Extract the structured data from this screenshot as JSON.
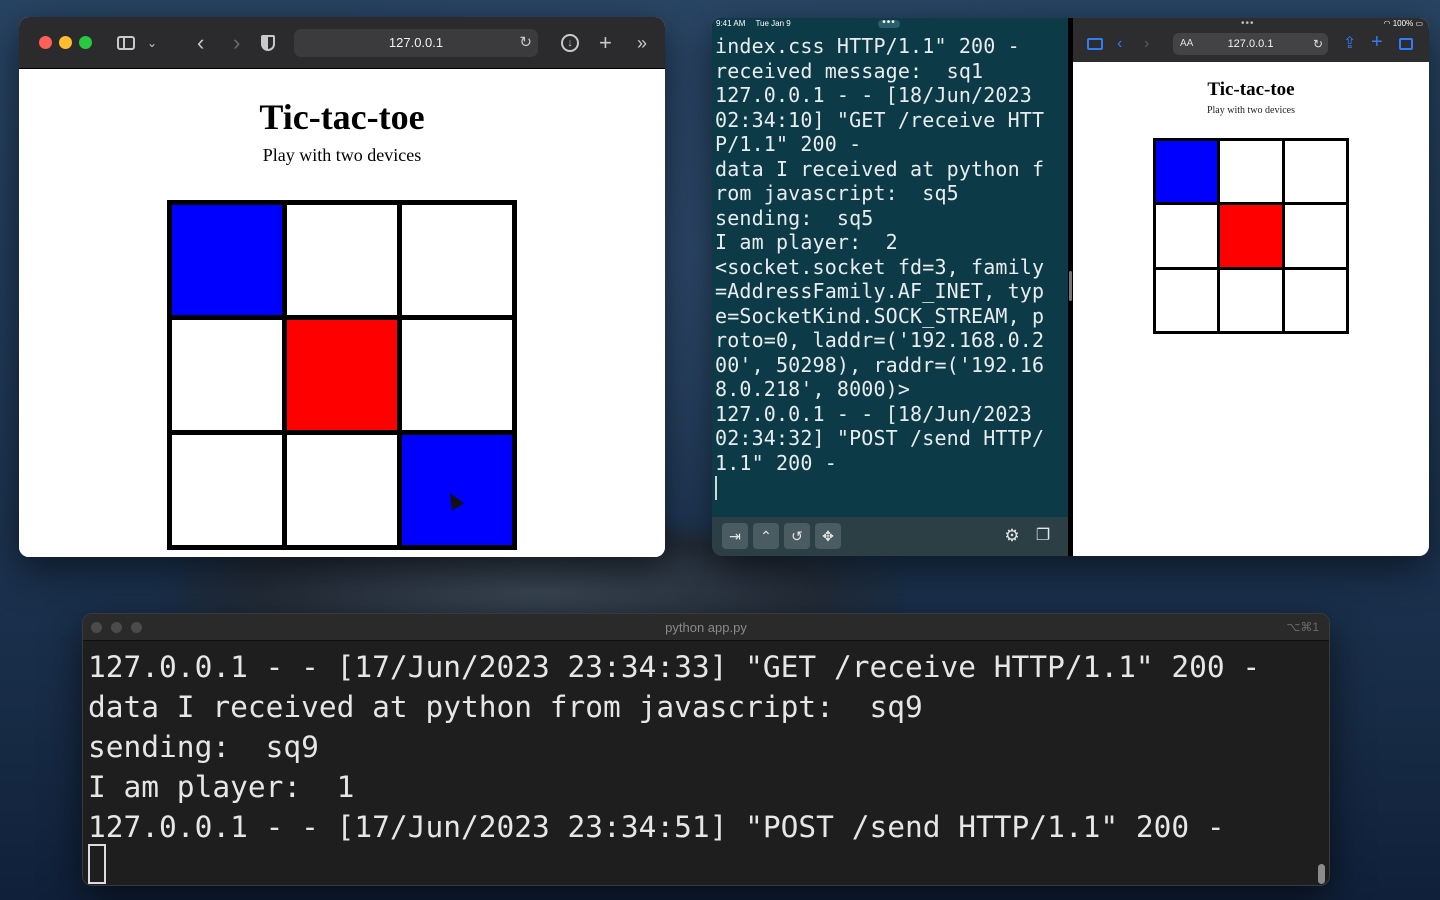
{
  "safari_left": {
    "url": "127.0.0.1",
    "title": "Tic-tac-toe",
    "subtitle": "Play with two devices",
    "board": [
      "blue",
      "empty",
      "empty",
      "empty",
      "red",
      "empty",
      "empty",
      "empty",
      "blue"
    ]
  },
  "ipad": {
    "time": "9:41 AM",
    "date": "Tue Jan 9",
    "battery": "100%",
    "terminal_lines": [
      "index.css HTTP/1.1\" 200 -",
      "received message:  sq1",
      "127.0.0.1 - - [18/Jun/2023",
      "02:34:10] \"GET /receive HTT",
      "P/1.1\" 200 -",
      "data I received at python f",
      "rom javascript:  sq5",
      "sending:  sq5",
      "I am player:  2",
      "<socket.socket fd=3, family",
      "=AddressFamily.AF_INET, typ",
      "e=SocketKind.SOCK_STREAM, p",
      "roto=0, laddr=('192.168.0.2",
      "00', 50298), raddr=('192.16",
      "8.0.218', 8000)>",
      "127.0.0.1 - - [18/Jun/2023",
      "02:34:32] \"POST /send HTTP/",
      "1.1\" 200 -"
    ],
    "safari": {
      "url": "127.0.0.1",
      "aa_label": "AA",
      "title": "Tic-tac-toe",
      "subtitle": "Play with two devices",
      "board": [
        "blue",
        "empty",
        "empty",
        "empty",
        "red",
        "empty",
        "empty",
        "empty",
        "empty"
      ]
    }
  },
  "terminal": {
    "title": "python app.py",
    "shortcut": "⌥⌘1",
    "lines": [
      "127.0.0.1 - - [17/Jun/2023 23:34:33] \"GET /receive HTTP/1.1\" 200 -",
      "data I received at python from javascript:  sq9",
      "sending:  sq9",
      "I am player:  1",
      "127.0.0.1 - - [17/Jun/2023 23:34:51] \"POST /send HTTP/1.1\" 200 -"
    ]
  },
  "colors": {
    "player_blue": "#0000ff",
    "player_red": "#ff0000",
    "ipad_terminal_bg": "#0c3b47"
  }
}
